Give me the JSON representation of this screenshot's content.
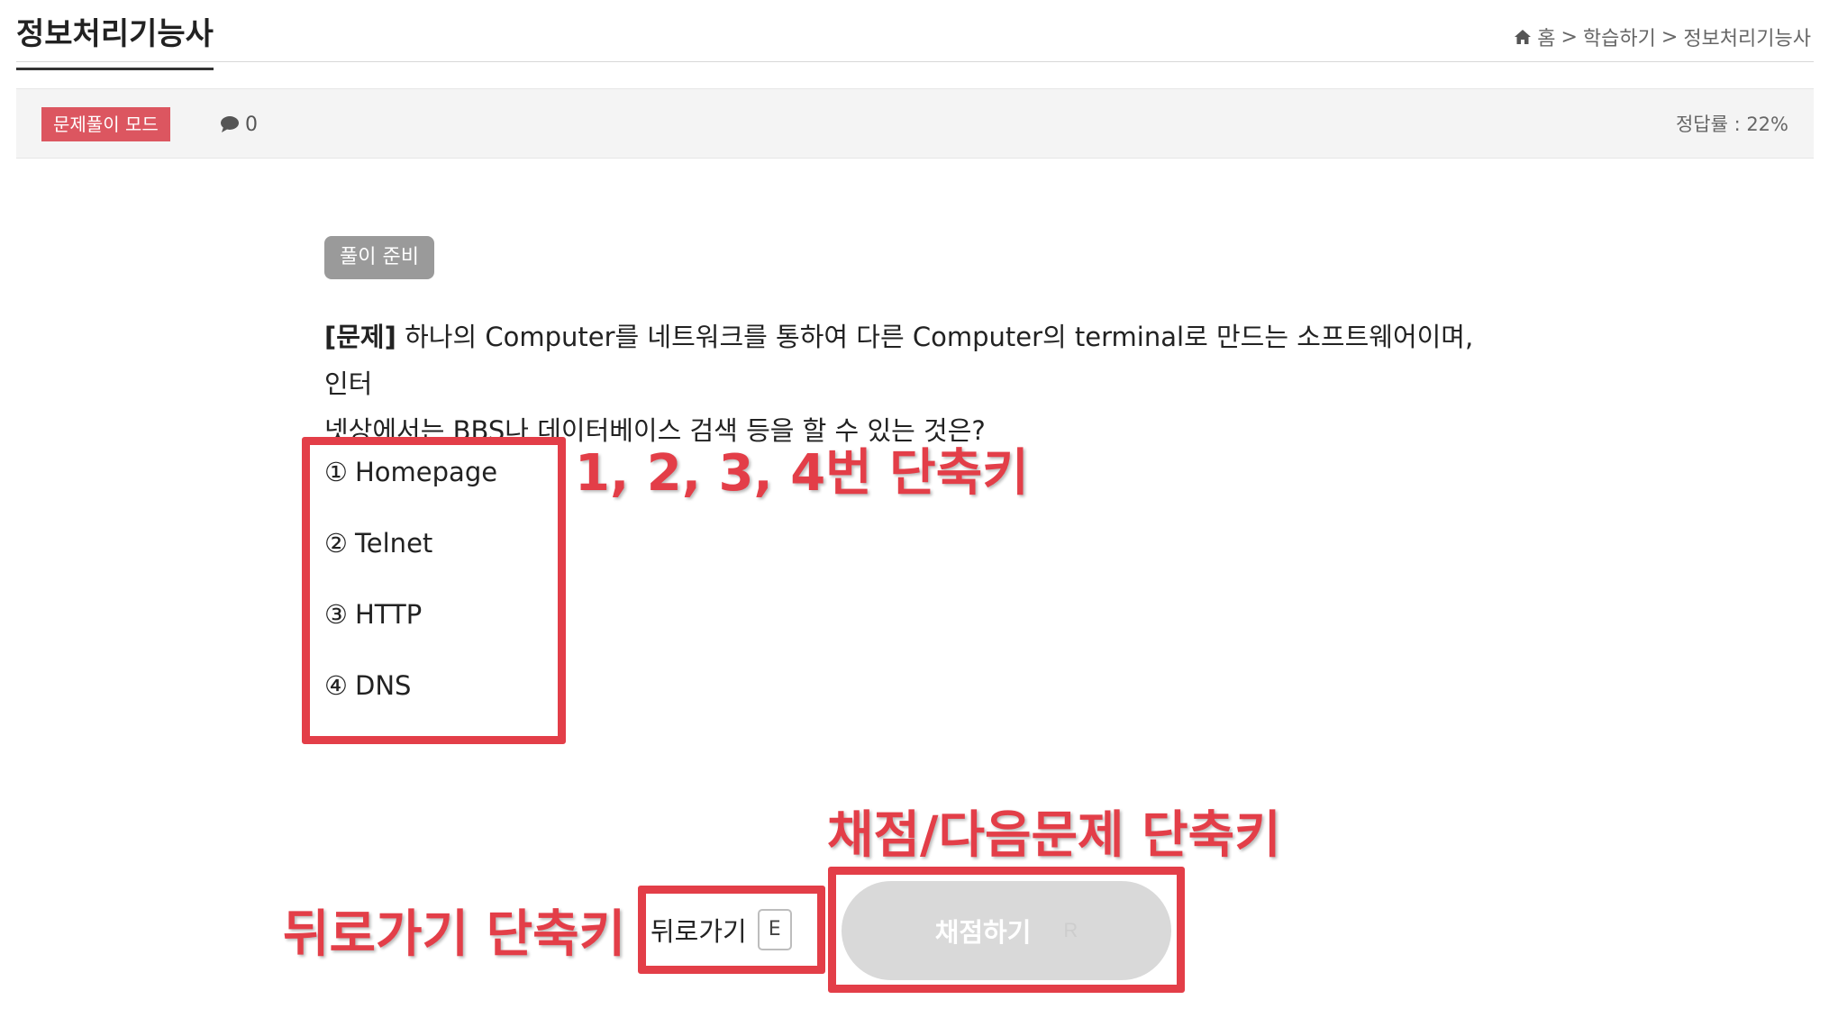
{
  "header": {
    "title": "정보처리기능사",
    "breadcrumb": {
      "home": "홈",
      "separator": ">",
      "section": "학습하기",
      "current": "정보처리기능사"
    }
  },
  "mode_bar": {
    "mode_label": "문제풀이 모드",
    "comment_count": "0",
    "accuracy": "정답률 : 22%"
  },
  "question": {
    "status": "풀이 준비",
    "label": "[문제]",
    "text_line1": " 하나의 Computer를 네트워크를 통하여 다른 Computer의 terminal로 만드는 소프트웨어이며, 인터",
    "text_line2": "넷상에서는 BBS나 데이터베이스 검색 등을 할 수 있는 것은?",
    "choices": [
      {
        "num": "①",
        "label": "Homepage"
      },
      {
        "num": "②",
        "label": "Telnet"
      },
      {
        "num": "③",
        "label": "HTTP"
      },
      {
        "num": "④",
        "label": "DNS"
      }
    ]
  },
  "actions": {
    "back_label": "뒤로가기",
    "back_key": "E",
    "grade_label": "채점하기",
    "grade_key": "R"
  },
  "annotations": {
    "choices_hint": "1, 2, 3, 4번 단축키",
    "grade_hint": "채점/다음문제 단축키",
    "back_hint": "뒤로가기 단축키"
  },
  "colors": {
    "annotation_red": "#e33e48",
    "mode_badge": "#dc5660",
    "status_chip": "#9a9a9a",
    "grade_button": "#d9d9d9"
  }
}
